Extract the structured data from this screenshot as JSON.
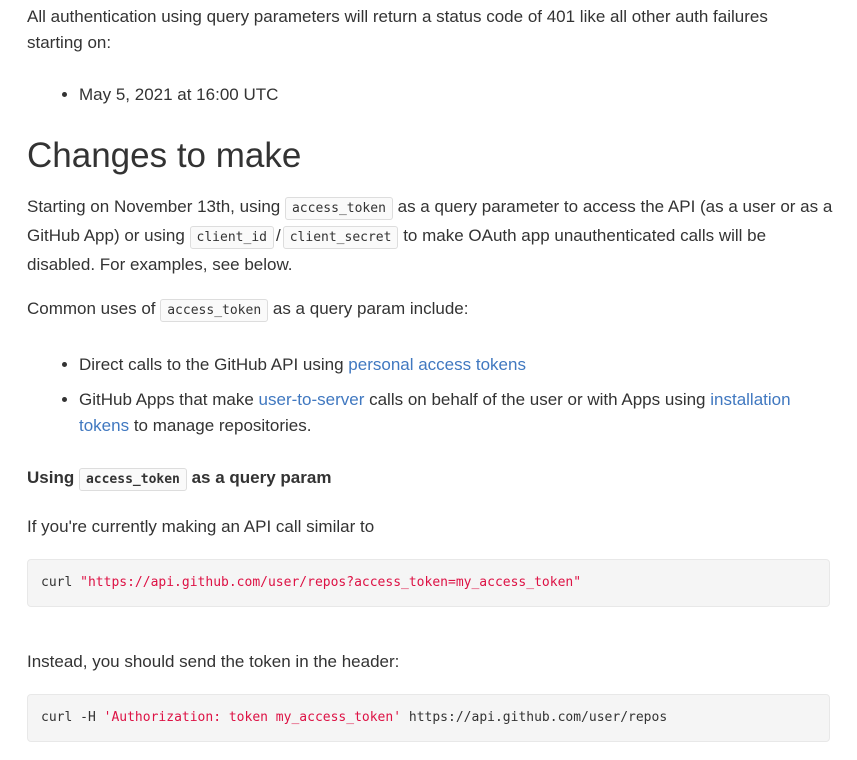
{
  "intro": {
    "text": "All authentication using query parameters will return a status code of 401 like all other auth failures starting on:",
    "bullets": [
      "May 5, 2021 at 16:00 UTC"
    ]
  },
  "section": {
    "title": "Changes to make",
    "para1_a": "Starting on November 13th, using ",
    "para1_code1": "access_token",
    "para1_b": " as a query parameter to access the API (as a user or as a GitHub App) or using ",
    "para1_code2": "client_id",
    "para1_slash": "/",
    "para1_code3": "client_secret",
    "para1_c": " to make OAuth app unauthenticated calls will be disabled. For examples, see below.",
    "para2_a": "Common uses of ",
    "para2_code": "access_token",
    "para2_b": " as a query param include:",
    "uses": {
      "item1_text": "Direct calls to the GitHub API using ",
      "item1_link": "personal access tokens",
      "item2_text_a": "GitHub Apps that make ",
      "item2_link1": "user-to-server",
      "item2_text_b": " calls on behalf of the user or with Apps using ",
      "item2_link2": "installation tokens",
      "item2_text_c": " to manage repositories."
    }
  },
  "subsection": {
    "title_a": "Using ",
    "title_code": "access_token",
    "title_b": " as a query param",
    "para1": "If you're currently making an API call similar to",
    "code1_cmd": "curl ",
    "code1_str": "\"https://api.github.com/user/repos?access_token=my_access_token\"",
    "para2": "Instead, you should send the token in the header:",
    "code2_cmd": "curl -H ",
    "code2_str": "'Authorization: token my_access_token'",
    "code2_rest": " https://api.github.com/user/repos"
  },
  "colors": {
    "link": "#4078c0",
    "string": "#d14",
    "text": "#333333"
  }
}
